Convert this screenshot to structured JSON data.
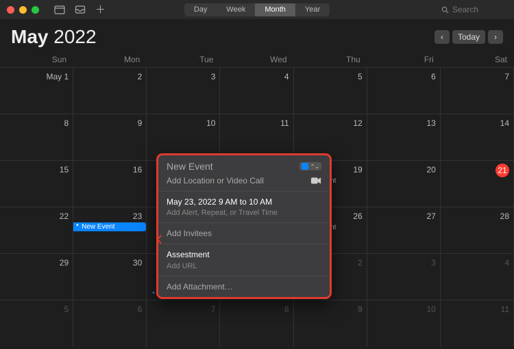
{
  "titlebar": {
    "views": [
      "Day",
      "Week",
      "Month",
      "Year"
    ],
    "active_view": "Month",
    "search_placeholder": "Search"
  },
  "header": {
    "month": "May",
    "year": "2022",
    "today_label": "Today"
  },
  "day_names": [
    "Sun",
    "Mon",
    "Tue",
    "Wed",
    "Thu",
    "Fri",
    "Sat"
  ],
  "grid": {
    "month_first_label": "May 1",
    "events": {
      "new_event_pill": "New Event",
      "dot_event": "New Event"
    }
  },
  "popover": {
    "title": "New Event",
    "location_placeholder": "Add Location or Video Call",
    "time": "May 23, 2022  9 AM to 10 AM",
    "alert_placeholder": "Add Alert, Repeat, or Travel Time",
    "invitees_placeholder": "Add Invitees",
    "notes_value": "Assestment",
    "url_placeholder": "Add URL",
    "attachment_placeholder": "Add Attachment…"
  }
}
